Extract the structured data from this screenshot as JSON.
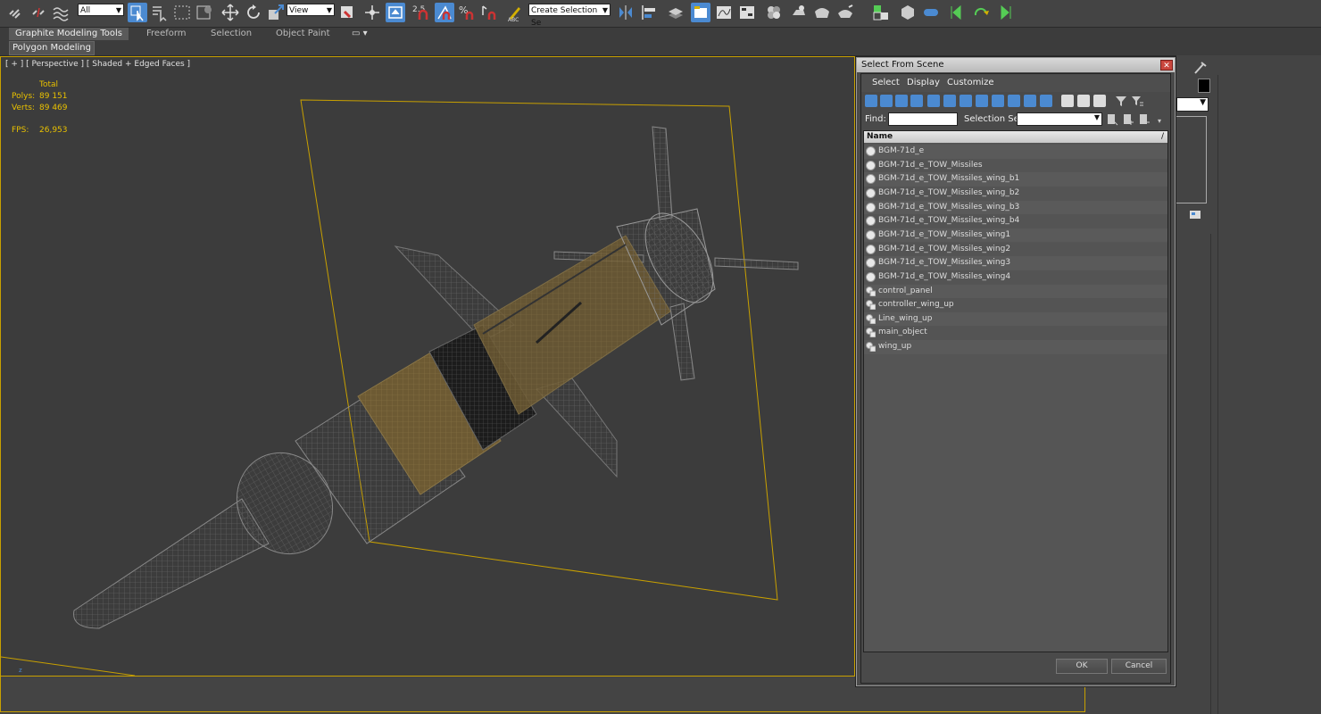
{
  "toolbar": {
    "filter_select": "All",
    "coord_select": "View",
    "angle_snap": "2.5",
    "percent_snap": "%",
    "named_selection": "Create Selection Se",
    "icons": [
      "link-icon",
      "unlink-icon",
      "bind-space-warp-icon",
      "select-object-icon",
      "select-by-name-icon",
      "rect-region-icon",
      "window-crossing-icon",
      "move-icon",
      "rotate-icon",
      "scale-icon",
      "select-manipulate-icon",
      "use-pivot-icon",
      "snap-toggle-icon",
      "angle-snap-icon",
      "percent-snap-icon",
      "spinner-snap-icon",
      "edit-named-sel-icon",
      "mirror-icon",
      "align-icon",
      "layer-icon",
      "scene-explorer-icon",
      "curve-editor-icon",
      "schematic-view-icon",
      "material-editor-icon",
      "render-setup-icon",
      "rendered-frame-icon",
      "render-icon"
    ]
  },
  "ribbon": {
    "tabs": [
      "Graphite Modeling Tools",
      "Freeform",
      "Selection",
      "Object Paint"
    ],
    "active_tab": "Graphite Modeling Tools",
    "panel": "Polygon Modeling"
  },
  "viewport": {
    "label": "[ + ] [ Perspective ] [ Shaded + Edged Faces ]",
    "stats": {
      "total_label": "Total",
      "polys_label": "Polys:",
      "polys": "89 151",
      "verts_label": "Verts:",
      "verts": "89 469",
      "fps_label": "FPS:",
      "fps": "26,953"
    },
    "colors": {
      "border": "#c8a000",
      "stats": "#e8c000",
      "background": "#3c3c3c"
    }
  },
  "dialog": {
    "title": "Select From Scene",
    "menu": [
      "Select",
      "Display",
      "Customize"
    ],
    "find_label": "Find:",
    "selection_set_label": "Selection Set:",
    "column_header": "Name",
    "items": [
      {
        "name": "BGM-71d_e",
        "icon": "geometry-icon"
      },
      {
        "name": "BGM-71d_e_TOW_Missiles",
        "icon": "geometry-icon"
      },
      {
        "name": "BGM-71d_e_TOW_Missiles_wing_b1",
        "icon": "geometry-icon"
      },
      {
        "name": "BGM-71d_e_TOW_Missiles_wing_b2",
        "icon": "geometry-icon"
      },
      {
        "name": "BGM-71d_e_TOW_Missiles_wing_b3",
        "icon": "geometry-icon"
      },
      {
        "name": "BGM-71d_e_TOW_Missiles_wing_b4",
        "icon": "geometry-icon"
      },
      {
        "name": "BGM-71d_e_TOW_Missiles_wing1",
        "icon": "geometry-icon"
      },
      {
        "name": "BGM-71d_e_TOW_Missiles_wing2",
        "icon": "geometry-icon"
      },
      {
        "name": "BGM-71d_e_TOW_Missiles_wing3",
        "icon": "geometry-icon"
      },
      {
        "name": "BGM-71d_e_TOW_Missiles_wing4",
        "icon": "geometry-icon"
      },
      {
        "name": "control_panel",
        "icon": "shape-icon"
      },
      {
        "name": "controller_wing_up",
        "icon": "shape-icon"
      },
      {
        "name": "Line_wing_up",
        "icon": "shape-icon"
      },
      {
        "name": "main_object",
        "icon": "shape-icon"
      },
      {
        "name": "wing_up",
        "icon": "shape-icon"
      }
    ],
    "ok_label": "OK",
    "cancel_label": "Cancel"
  }
}
